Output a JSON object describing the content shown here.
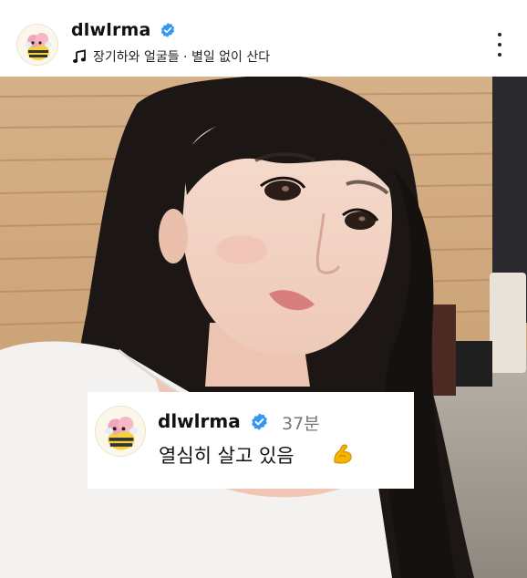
{
  "header": {
    "username": "dlwlrma",
    "music_line": "장기하와 얼굴들 · 별일 없이 산다",
    "avatar_icon": "bee-character-avatar",
    "verified_icon": "verified-badge-icon",
    "music_icon": "music-note-icon",
    "more_icon": "more-vertical-icon"
  },
  "comment": {
    "username": "dlwlrma",
    "time": "37분",
    "text": "열심히 살고 있음",
    "emoji_icon": "flexed-biceps-icon"
  },
  "colors": {
    "verified": "#3797f0",
    "time_text": "#777777",
    "background": "#ffffff"
  }
}
